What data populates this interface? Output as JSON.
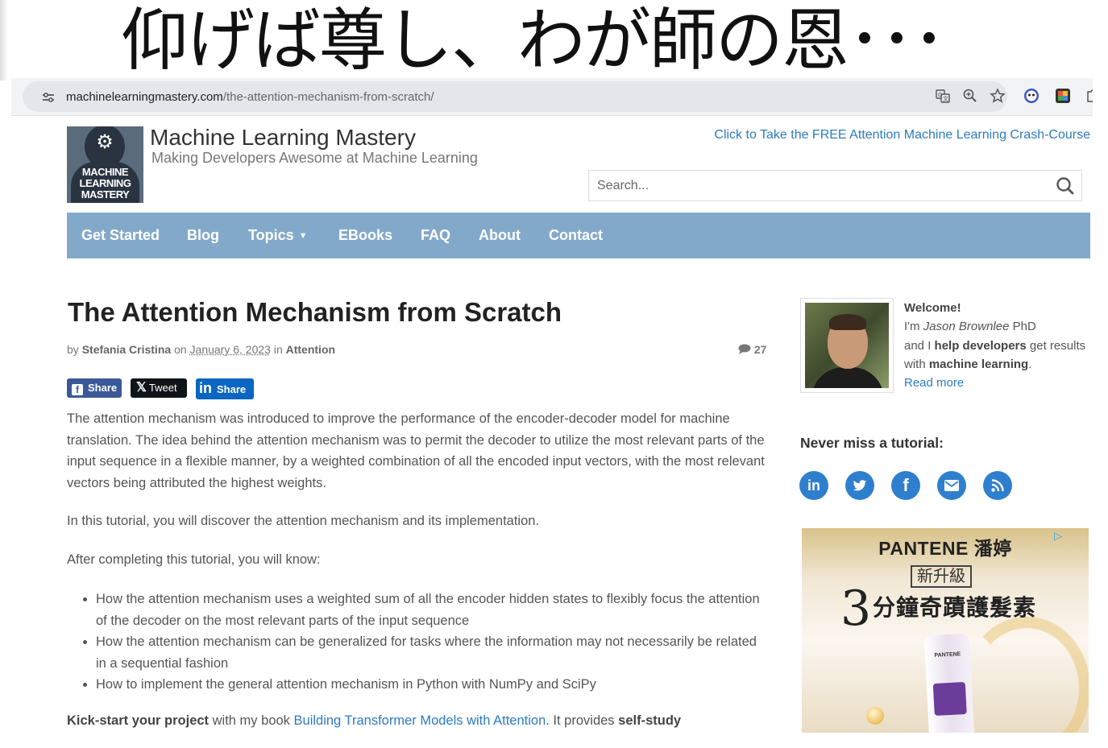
{
  "slide": {
    "title": "仰げば尊し、わが師の恩･･･"
  },
  "browser": {
    "url_domain": "machinelearningmastery.com",
    "url_path": "/the-attention-mechanism-from-scratch/",
    "icons": [
      "site-info-icon",
      "translate-icon",
      "zoom-icon",
      "bookmark-star-icon",
      "extension-icon",
      "extension-icon",
      "extensions-puzzle-icon"
    ]
  },
  "site": {
    "logo_text_1": "MACHINE",
    "logo_text_2": "LEARNING",
    "logo_text_3": "MASTERY",
    "name": "Machine Learning Mastery",
    "tagline": "Making Developers Awesome at Machine Learning",
    "crash_course_link": "Click to Take the FREE Attention Machine Learning Crash-Course",
    "search_placeholder": "Search..."
  },
  "nav": {
    "items": [
      {
        "label": "Get Started"
      },
      {
        "label": "Blog"
      },
      {
        "label": "Topics"
      },
      {
        "label": "EBooks"
      },
      {
        "label": "FAQ"
      },
      {
        "label": "About"
      },
      {
        "label": "Contact"
      }
    ],
    "bg_color": "#83a9ca"
  },
  "article": {
    "title": "The Attention Mechanism from Scratch",
    "by_prefix": "by",
    "author": "Stefania Cristina",
    "on_word": "on",
    "date": "January 6, 2023",
    "in_word": "in",
    "category": "Attention",
    "comment_count": "27",
    "share_buttons": {
      "facebook": "Share",
      "x": "Tweet",
      "linkedin": "Share"
    },
    "paragraph_1": "The attention mechanism was introduced to improve the performance of the encoder-decoder model for machine translation. The idea behind the attention mechanism was to permit the decoder to utilize the most relevant parts of the input sequence in a flexible manner, by a weighted combination of all the encoded input vectors, with the most relevant vectors being attributed the highest weights.",
    "paragraph_2": "In this tutorial, you will discover the attention mechanism and its implementation.",
    "paragraph_3": "After completing this tutorial, you will know:",
    "learn_items": [
      "How the attention mechanism uses a weighted sum of all the encoder hidden states to flexibly focus the attention of the decoder on the most relevant parts of the input sequence",
      "How the attention mechanism can be generalized for tasks where the information may not necessarily be related in a sequential fashion",
      "How to implement the general attention mechanism in Python with NumPy and SciPy"
    ],
    "cta_bold_1": "Kick-start your project",
    "cta_text_1": " with my book ",
    "cta_link": "Building Transformer Models with Attention",
    "cta_text_2": ". It provides ",
    "cta_bold_2": "self-study"
  },
  "sidebar": {
    "welcome_title": "Welcome!",
    "welcome_im": "I'm ",
    "welcome_name": "Jason Brownlee",
    "welcome_phd": " PhD",
    "welcome_and": "and I ",
    "welcome_help": "help developers",
    "welcome_get": " get results with ",
    "welcome_ml": "machine learning",
    "welcome_period": ".",
    "read_more": "Read more",
    "never_miss": "Never miss a tutorial:",
    "social_icons": [
      "linkedin-icon",
      "twitter-icon",
      "facebook-icon",
      "email-icon",
      "rss-icon"
    ]
  },
  "ad": {
    "brand": "PANTENE 潘婷",
    "subtitle": "新升級",
    "digit": "3",
    "headline": "分鐘奇蹟護髮素",
    "tube_brand": "PANTENE"
  },
  "colors": {
    "link": "#2e7bbf",
    "nav": "#83a9ca",
    "facebook": "#3b5998",
    "linkedin": "#0a66c2",
    "social_circle": "#2f7fcf"
  }
}
